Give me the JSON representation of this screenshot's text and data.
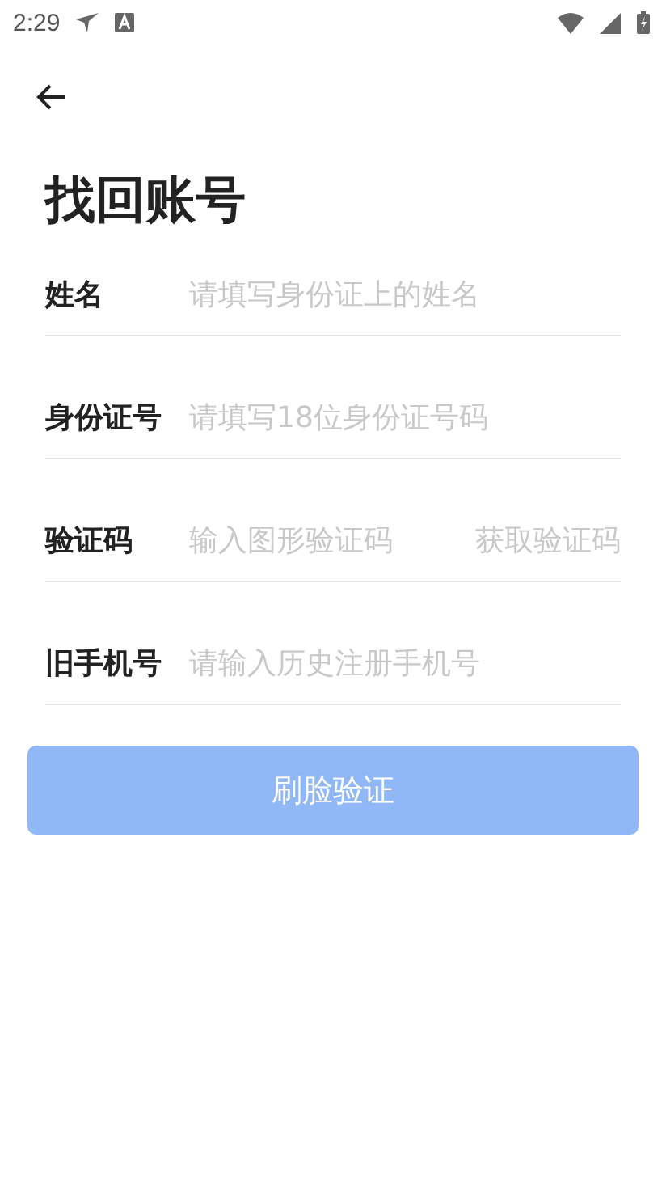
{
  "status_bar": {
    "time": "2:29"
  },
  "title": "找回账号",
  "fields": [
    {
      "label": "姓名",
      "placeholder": "请填写身份证上的姓名"
    },
    {
      "label": "身份证号",
      "placeholder": "请填写18位身份证号码"
    },
    {
      "label": "验证码",
      "placeholder": "输入图形验证码",
      "action": {
        "label": "获取验证码",
        "disabled": true
      }
    },
    {
      "label": "旧手机号",
      "placeholder": "请输入历史注册手机号"
    }
  ],
  "submit": {
    "label": "刷脸验证",
    "disabled": true
  }
}
